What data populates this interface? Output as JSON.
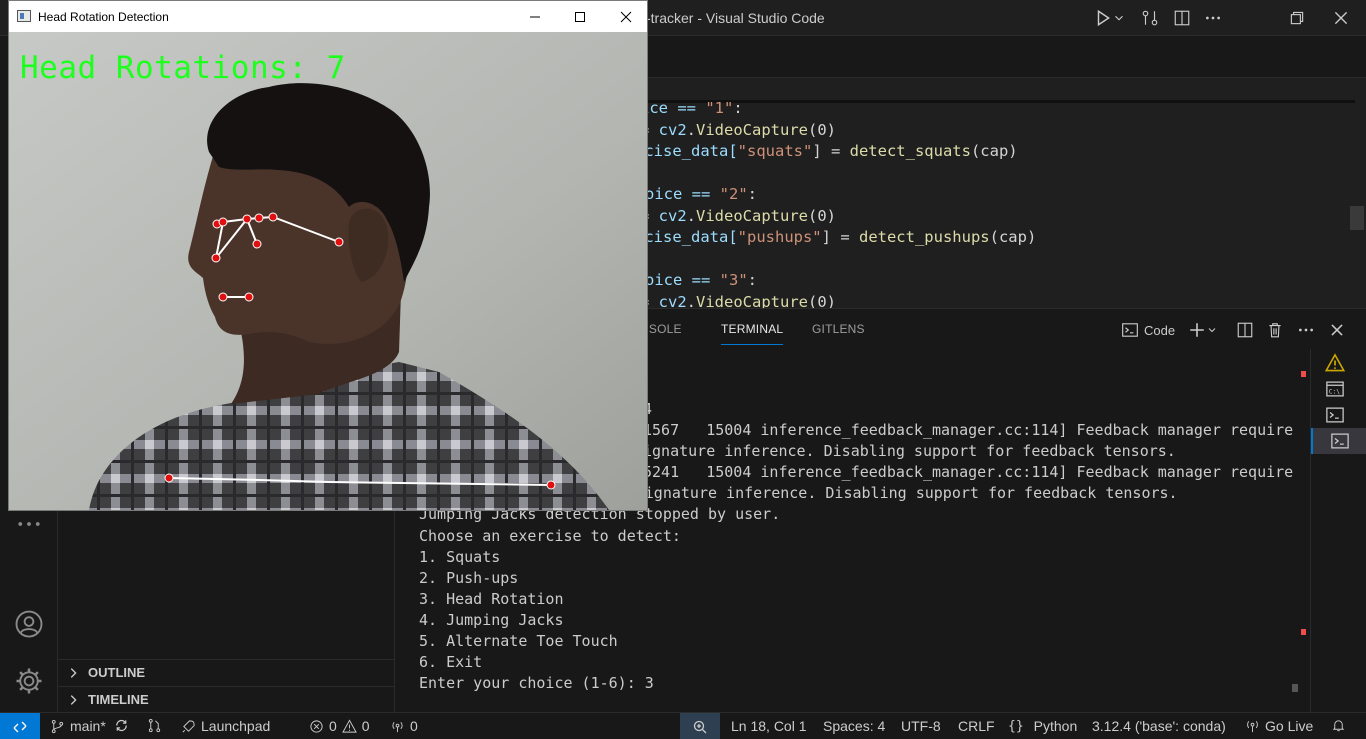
{
  "vscode": {
    "window_title": "-tracker - Visual Studio Code",
    "editor_lines": [
      [
        "ice == ",
        "\"1\"",
        ":"
      ],
      [
        "= ",
        "cv2",
        ".",
        "VideoCapture",
        "(0)"
      ],
      [
        "rcise_data[",
        "\"squats\"",
        "] = ",
        "detect_squats",
        "(cap)"
      ],
      [],
      [
        "oice == ",
        "\"2\"",
        ":"
      ],
      [
        "= ",
        "cv2",
        ".",
        "VideoCapture",
        "(0)"
      ],
      [
        "rcise_data[",
        "\"pushups\"",
        "] = ",
        "detect_pushups",
        "(cap)"
      ],
      [],
      [
        "oice == ",
        "\"3\"",
        ":"
      ],
      [
        "= ",
        "cv2",
        ".",
        "VideoCapture",
        "(0)"
      ]
    ],
    "panel": {
      "tabs": [
        "NSOLE",
        "TERMINAL",
        "GITLENS"
      ],
      "active_tab": "TERMINAL",
      "terminal_profile": "Code",
      "terminal_lines": [
        "4",
        "1567   15004 inference_feedback_manager.cc:114] Feedback manager require",
        "ignature inference. Disabling support for feedback tensors.",
        "5241   15004 inference_feedback_manager.cc:114] Feedback manager require",
        "s a model with a single signature inference. Disabling support for feedback tensors.",
        "Jumping Jacks detection stopped by user.",
        "Choose an exercise to detect:",
        "1. Squats",
        "2. Push-ups",
        "3. Head Rotation",
        "4. Jumping Jacks",
        "5. Alternate Toe Touch",
        "6. Exit",
        "Enter your choice (1-6): 3"
      ]
    },
    "sidebar_sections": [
      "OUTLINE",
      "TIMELINE"
    ],
    "status": {
      "branch": "main*",
      "launchpad": "Launchpad",
      "errors": "0",
      "warnings": "0",
      "ports": "0",
      "position": "Ln 18, Col 1",
      "spaces": "Spaces: 4",
      "encoding": "UTF-8",
      "eol": "CRLF",
      "language": "Python",
      "interpreter": "3.12.4 ('base': conda)",
      "golive": "Go Live"
    }
  },
  "opencv_window": {
    "title": "Head Rotation Detection",
    "counter_text": "Head Rotations: 7",
    "counter_color": "#1dff1d"
  },
  "colors": {
    "accent": "#0078d4",
    "warning": "#cca700",
    "error_marker": "#f14c4c"
  }
}
